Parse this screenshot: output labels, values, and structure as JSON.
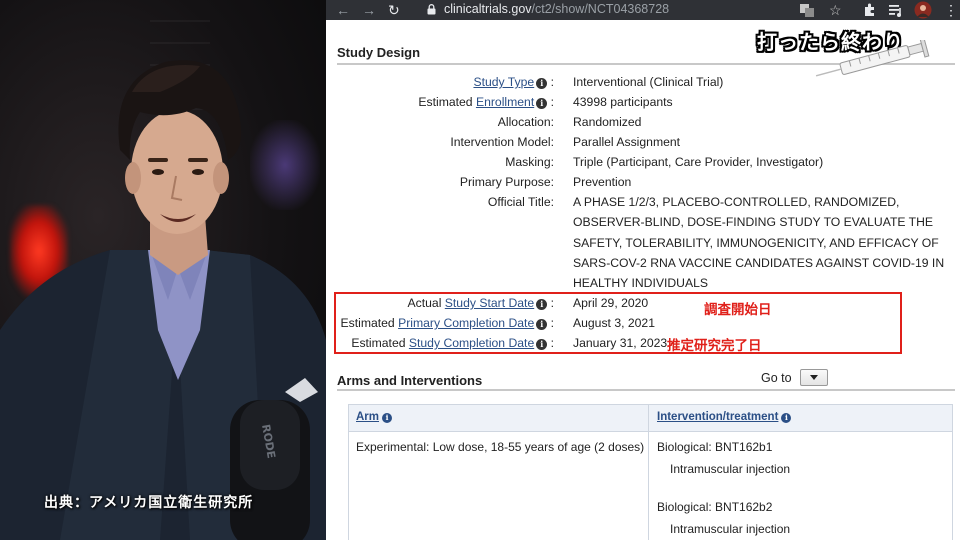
{
  "overlay": {
    "top_caption": "打ったら終わり",
    "source_caption": "出典：アメリカ国立衛生研究所"
  },
  "browser": {
    "url_host": "clinicaltrials.gov",
    "url_path": "/ct2/show/NCT04368728",
    "icons": [
      "back-arrow-icon",
      "forward-arrow-icon",
      "reload-icon",
      "lock-icon",
      "translate-icon",
      "star-icon",
      "puzzle-icon",
      "media-playlist-icon",
      "profile-avatar"
    ]
  },
  "study_design": {
    "heading": "Study Design",
    "rows": [
      {
        "prefix": "",
        "link": "Study Type",
        "info": true,
        "value": "Interventional  (Clinical Trial)"
      },
      {
        "prefix": "Estimated ",
        "link": "Enrollment",
        "info": true,
        "value": "43998 participants"
      },
      {
        "prefix": "Allocation:",
        "link": "",
        "info": false,
        "value": "Randomized"
      },
      {
        "prefix": "Intervention Model:",
        "link": "",
        "info": false,
        "value": "Parallel Assignment"
      },
      {
        "prefix": "Masking:",
        "link": "",
        "info": false,
        "value": "Triple (Participant, Care Provider, Investigator)"
      },
      {
        "prefix": "Primary Purpose:",
        "link": "",
        "info": false,
        "value": "Prevention"
      },
      {
        "prefix": "Official Title:",
        "link": "",
        "info": false,
        "value": "A PHASE 1/2/3, PLACEBO-CONTROLLED, RANDOMIZED, OBSERVER-BLIND, DOSE-FINDING STUDY TO EVALUATE THE SAFETY, TOLERABILITY, IMMUNOGENICITY, AND EFFICACY OF SARS-COV-2 RNA VACCINE CANDIDATES AGAINST COVID-19 IN HEALTHY INDIVIDUALS"
      },
      {
        "prefix": "Actual ",
        "link": "Study Start Date",
        "info": true,
        "value": "April 29, 2020"
      },
      {
        "prefix": "Estimated ",
        "link": "Primary Completion Date",
        "info": true,
        "value": "August 3, 2021"
      },
      {
        "prefix": "Estimated ",
        "link": "Study Completion Date",
        "info": true,
        "value": "January 31, 2023"
      }
    ],
    "annotation_start": "調査開始日",
    "annotation_completion": "推定研究完了日",
    "highlight_color": "#e0201a"
  },
  "arms": {
    "heading": "Arms and Interventions",
    "goto_label": "Go to",
    "col_arm": "Arm",
    "col_intervention": "Intervention/treatment",
    "rows": [
      {
        "arm": "Experimental: Low dose, 18-55 years of age (2 doses)",
        "interventions": [
          {
            "name": "Biological: BNT162b1",
            "route": "Intramuscular injection"
          },
          {
            "name": "Biological: BNT162b2",
            "route": "Intramuscular injection"
          }
        ]
      }
    ]
  },
  "colors": {
    "link": "#2b4f86",
    "table_header_bg": "#eef2f8",
    "chrome_bar": "#2f3136"
  }
}
